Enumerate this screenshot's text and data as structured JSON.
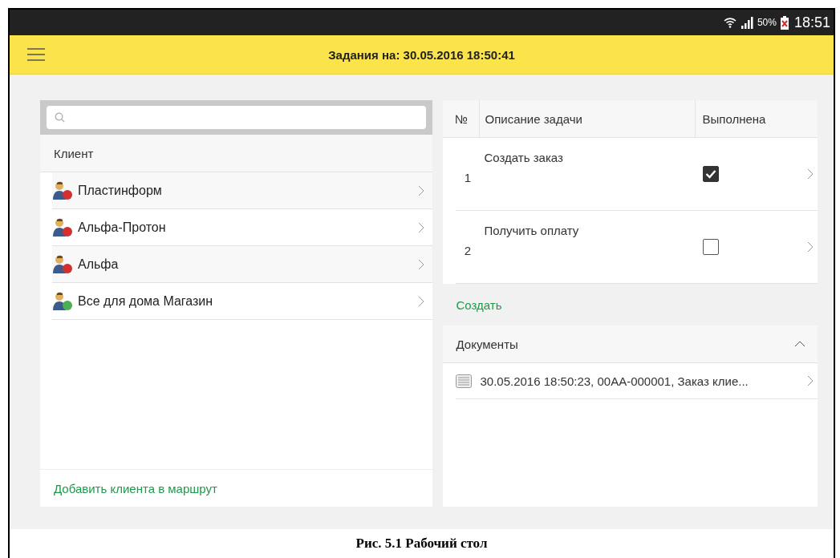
{
  "status_bar": {
    "battery": "50%",
    "time": "18:51"
  },
  "header": {
    "title": "Задания на: 30.05.2016 18:50:41"
  },
  "clients": {
    "column": "Клиент",
    "rows": [
      {
        "name": "Пластинформ",
        "color": "#d32f2f"
      },
      {
        "name": "Альфа-Протон",
        "color": "#d32f2f"
      },
      {
        "name": "Альфа",
        "color": "#d32f2f"
      },
      {
        "name": "Все для дома Магазин",
        "color": "#4caf50"
      }
    ],
    "add_link": "Добавить клиента в маршрут"
  },
  "tasks": {
    "columns": [
      "№",
      "Описание задачи",
      "Выполнена"
    ],
    "rows": [
      {
        "number": "1",
        "description": "Создать заказ",
        "checked": true
      },
      {
        "number": "2",
        "description": "Получить оплату",
        "checked": false
      }
    ],
    "create_link": "Создать"
  },
  "documents": {
    "title": "Документы",
    "expanded": true,
    "rows": [
      "30.05.2016 18:50:23, 00АА-000001, Заказ клие..."
    ]
  },
  "caption": "Рис. 5.1 Рабочий стол"
}
